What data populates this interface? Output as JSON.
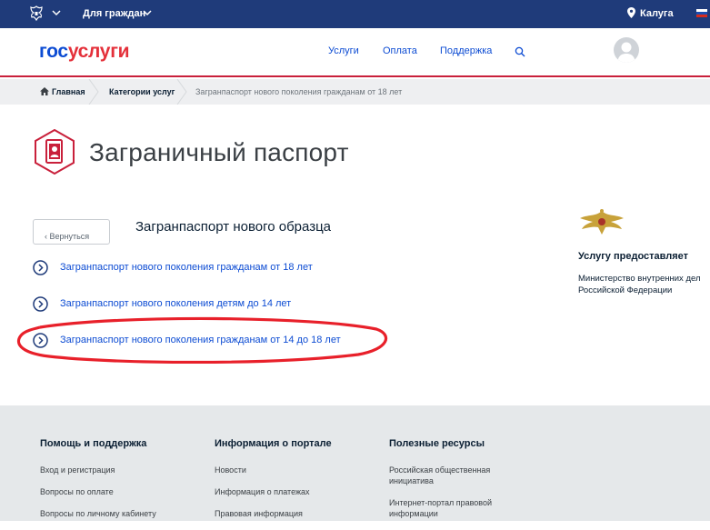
{
  "topbar": {
    "audience_label": "Для граждан",
    "region": "Калуга",
    "bg_color": "#1f3b7a"
  },
  "header": {
    "logo_part1": "гос",
    "logo_part2": "услуги",
    "nav": [
      "Услуги",
      "Оплата",
      "Поддержка"
    ],
    "icons": [
      "search-icon",
      "avatar"
    ]
  },
  "breadcrumb": {
    "items": [
      "Главная",
      "Категории услуг",
      "Загранпаспорт нового поколения гражданам от 18 лет"
    ]
  },
  "page": {
    "title": "Заграничный паспорт",
    "back_label": "Вернуться",
    "section_title": "Загранпаспорт нового образца",
    "links": [
      "Загранпаспорт нового поколения гражданам от 18 лет",
      "Загранпаспорт нового поколения детям до 14 лет",
      "Загранпаспорт нового поколения гражданам от 14 до 18 лет"
    ],
    "accent_color": "#c9203b",
    "link_color": "#0d4cd3"
  },
  "provider": {
    "label": "Услугу предоставляет",
    "agency_line1": "Министерство внутренних дел",
    "agency_line2": "Российской Федерации"
  },
  "footer": {
    "columns": [
      {
        "title": "Помощь и поддержка",
        "links": [
          "Вход и регистрация",
          "Вопросы по оплате",
          "Вопросы по личному кабинету"
        ]
      },
      {
        "title": "Информация о портале",
        "links": [
          "Новости",
          "Информация о платежах",
          "Правовая информация"
        ]
      },
      {
        "title": "Полезные ресурсы",
        "links": [
          "Российская общественная инициатива",
          "Интернет-портал правовой информации"
        ]
      }
    ]
  }
}
